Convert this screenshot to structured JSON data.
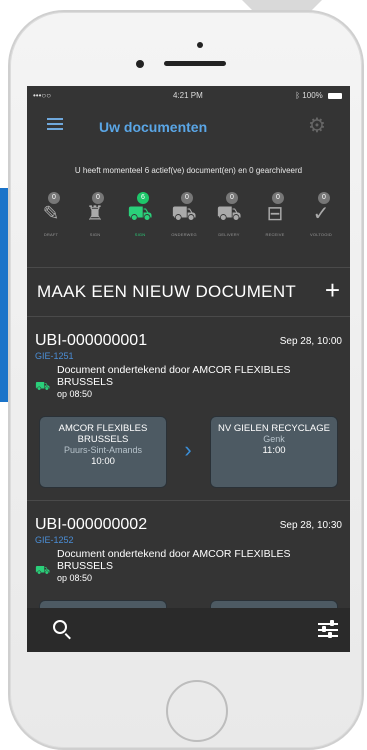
{
  "status_bar": {
    "carrier": "•••○○ ",
    "time": "4:21 PM",
    "battery": "100%"
  },
  "header": {
    "title": "Uw documenten",
    "menu_icon": "hamburger-icon",
    "settings_icon": "gear-icon"
  },
  "summary": "U heeft momenteel 6 actief(ve) document(en) en 0 gearchiveerd",
  "filters": [
    {
      "count": "0",
      "icon": "pencil-icon",
      "label": "DRAFT",
      "active": false
    },
    {
      "count": "0",
      "icon": "stamp-icon",
      "label": "SIGN",
      "active": false
    },
    {
      "count": "6",
      "icon": "signed-truck-icon",
      "label": "SIGN",
      "active": true
    },
    {
      "count": "0",
      "icon": "truck-icon",
      "label": "ONDERWEG",
      "active": false
    },
    {
      "count": "0",
      "icon": "delivery-truck-icon",
      "label": "DELIVERY",
      "active": false
    },
    {
      "count": "0",
      "icon": "box-icon",
      "label": "RECEIVE",
      "active": false
    },
    {
      "count": "0",
      "icon": "check-icon",
      "label": "VOLTOOID",
      "active": false
    }
  ],
  "new_document": {
    "label": "MAAK EEN NIEUW DOCUMENT",
    "icon": "plus-icon"
  },
  "documents": [
    {
      "id": "UBI-000000001",
      "date": "Sep 28, 10:00",
      "ref": "GIE-1251",
      "message": "Document ondertekend door AMCOR FLEXIBLES BRUSSELS",
      "time": "op 08:50",
      "from": {
        "name": "AMCOR FLEXIBLES BRUSSELS",
        "city": "Puurs-Sint-Amands",
        "time": "10:00"
      },
      "to": {
        "name": "NV GIELEN RECYCLAGE",
        "city": "Genk",
        "time": "11:00"
      }
    },
    {
      "id": "UBI-000000002",
      "date": "Sep 28, 10:30",
      "ref": "GIE-1252",
      "message": "Document ondertekend door AMCOR FLEXIBLES BRUSSELS",
      "time": "op 08:50"
    }
  ],
  "bottom_bar": {
    "search_icon": "search-icon",
    "filter_icon": "sliders-icon"
  },
  "colors": {
    "screen_bg": "#343434",
    "accent_blue": "#5aa6e6",
    "active_green": "#2ad07a",
    "card_bg": "#4d5a63"
  }
}
